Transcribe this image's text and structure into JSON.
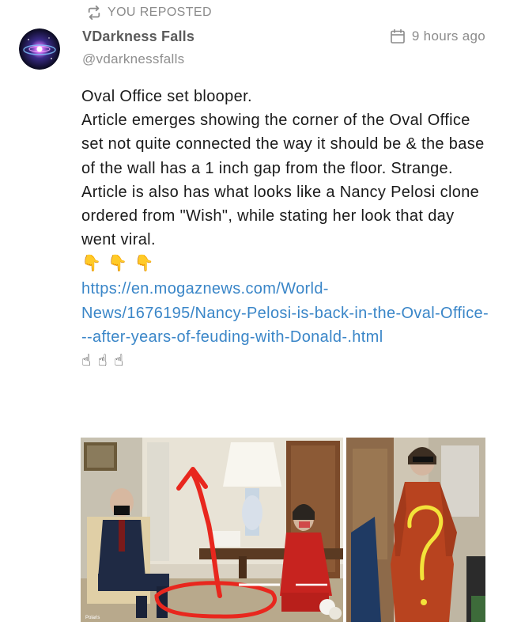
{
  "repost": {
    "label": "YOU REPOSTED",
    "icon": "repost-icon"
  },
  "author": {
    "name": "VDarkness Falls",
    "handle": "@vdarknessfalls",
    "avatar_icon": "galaxy-avatar"
  },
  "timestamp": {
    "icon": "calendar-icon",
    "text": "9 hours ago"
  },
  "post": {
    "line1": "Oval Office set blooper.",
    "paragraph": "Article emerges showing the corner of the Oval Office set not quite connected the way it should be & the base of the wall has a 1 inch gap from the floor. Strange. Article is also has what looks like a Nancy Pelosi clone ordered from \"Wish\", while stating her look that day went viral.",
    "emoji_down": [
      "👇",
      "👇",
      "👇"
    ],
    "link": "https://en.mogaznews.com/World-News/1676195/Nancy-Pelosi-is-back-in-the-Oval-Office---after-years-of-feuding-with-Donald-.html",
    "emoji_up": [
      "☝",
      "☝",
      "☝"
    ]
  },
  "media": {
    "image_watermark": "Polaris"
  },
  "colors": {
    "link": "#3a86c8",
    "muted": "#8b8b8b",
    "annotation_red": "#e8271e",
    "annotation_yellow": "#f3e23a"
  }
}
